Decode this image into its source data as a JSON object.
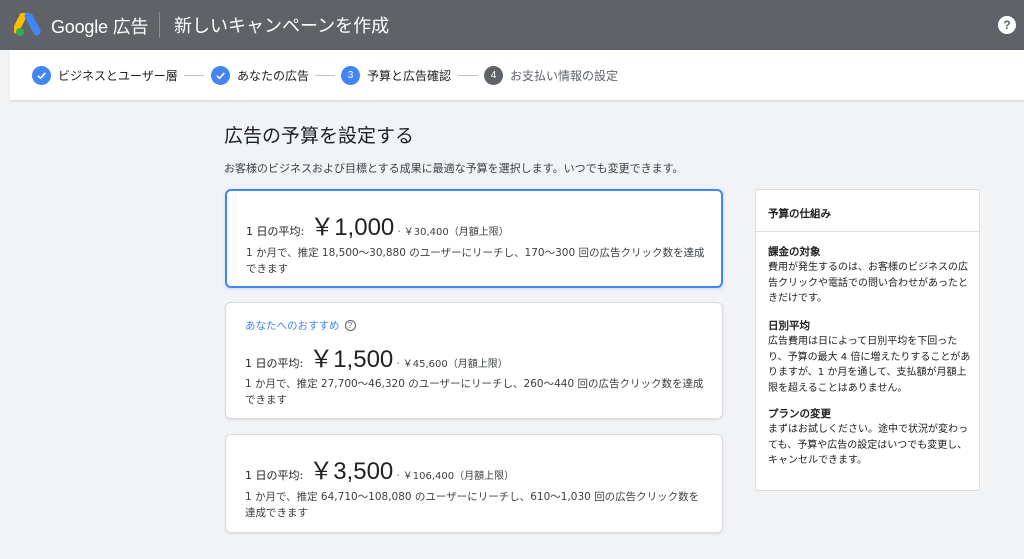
{
  "header": {
    "logo_text": "Google 広告",
    "title": "新しいキャンペーンを作成",
    "help_label": "?"
  },
  "stepper": {
    "steps": [
      {
        "label": "ビジネスとユーザー層",
        "state": "done"
      },
      {
        "label": "あなたの広告",
        "state": "done"
      },
      {
        "number": "3",
        "label": "予算と広告確認",
        "state": "active"
      },
      {
        "number": "4",
        "label": "お支払い情報の設定",
        "state": "todo"
      }
    ]
  },
  "main": {
    "title": "広告の予算を設定する",
    "subtitle": "お客様のビジネスおよび目標とする成果に最適な予算を選択します。いつでも変更できます。",
    "options": [
      {
        "avg_label": "1 日の平均:",
        "amount": "￥1,000",
        "dot": "·",
        "monthly": "￥30,400（月額上限）",
        "desc": "1 か月で、推定 18,500～30,880 のユーザーにリーチし、170～300 回の広告クリック数を達成できます",
        "selected": true
      },
      {
        "badge": "あなたへのおすすめ",
        "avg_label": "1 日の平均:",
        "amount": "￥1,500",
        "dot": "·",
        "monthly": "￥45,600（月額上限）",
        "desc": "1 か月で、推定 27,700～46,320 のユーザーにリーチし、260～440 回の広告クリック数を達成できます",
        "selected": false
      },
      {
        "avg_label": "1 日の平均:",
        "amount": "￥3,500",
        "dot": "·",
        "monthly": "￥106,400（月額上限）",
        "desc": "1 か月で、推定 64,710～108,080 のユーザーにリーチし、610～1,030 回の広告クリック数を達成できます",
        "selected": false
      }
    ]
  },
  "side": {
    "title": "予算の仕組み",
    "sections": [
      {
        "heading": "課金の対象",
        "body": "費用が発生するのは、お客様のビジネスの広告クリックや電話での問い合わせがあったときだけです。"
      },
      {
        "heading": "日別平均",
        "body": "広告費用は日によって日別平均を下回ったり、予算の最大 4 倍に増えたりすることがありますが、1 か月を通して、支払額が月額上限を超えることはありません。"
      },
      {
        "heading": "プランの変更",
        "body": "まずはお試しください。途中で状況が変わっても、予算や広告の設定はいつでも変更し、キャンセルできます。"
      }
    ]
  },
  "colors": {
    "header_bg": "#5f6368",
    "accent": "#4285f4",
    "page_bg": "#f1f3f4"
  }
}
